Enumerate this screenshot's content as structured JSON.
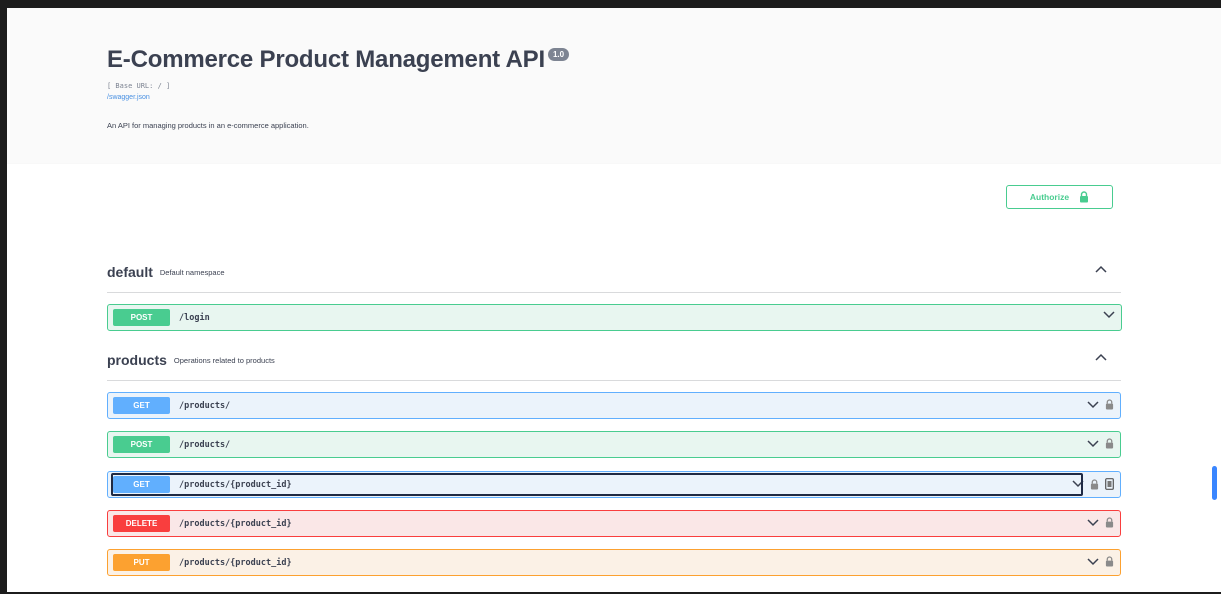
{
  "info": {
    "title": "E-Commerce Product Management API",
    "version": "1.0",
    "base_url": "[ Base URL: / ]",
    "spec_link": "/swagger.json",
    "description": "An API for managing products in an e-commerce application."
  },
  "auth": {
    "authorize_label": "Authorize"
  },
  "tags": [
    {
      "name": "default",
      "description": "Default namespace",
      "operations": [
        {
          "method": "POST",
          "path": "/login"
        }
      ]
    },
    {
      "name": "products",
      "description": "Operations related to products",
      "operations": [
        {
          "method": "GET",
          "path": "/products/"
        },
        {
          "method": "POST",
          "path": "/products/"
        },
        {
          "method": "GET",
          "path": "/products/{product_id}"
        },
        {
          "method": "DELETE",
          "path": "/products/{product_id}"
        },
        {
          "method": "PUT",
          "path": "/products/{product_id}"
        }
      ]
    }
  ],
  "colors": {
    "get": "#61affe",
    "post": "#49cc90",
    "delete": "#f93e3e",
    "put": "#fca130",
    "text": "#3b4151"
  },
  "icons": {
    "collapse": "chevron-up-icon",
    "expand": "chevron-down-icon",
    "lock": "lock-icon",
    "copy": "copy-icon"
  }
}
